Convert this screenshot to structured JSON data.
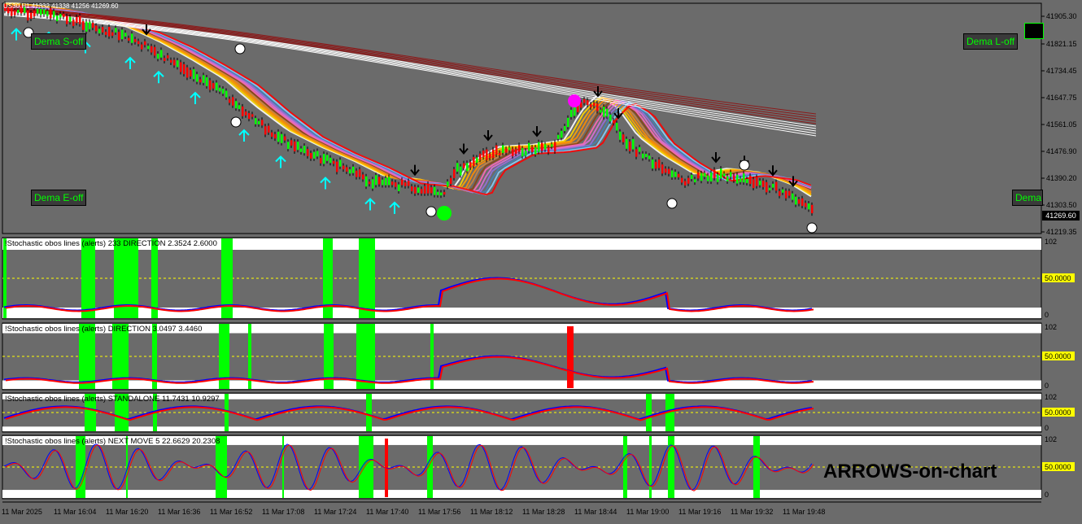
{
  "top_info": "US30.H1  41332  41338  41256  41269.60",
  "main_chart": {
    "buttons": [
      {
        "label": "Dema S-off"
      },
      {
        "label": "Dema L-off"
      },
      {
        "label": "Dema E-off"
      },
      {
        "label": "Dema U"
      }
    ],
    "price_ticks": [
      "41905.30",
      "41821.15",
      "41734.45",
      "41647.75",
      "41561.05",
      "41476.90",
      "41390.20",
      "41303.50",
      "41219.35"
    ],
    "current_price": "41269.60"
  },
  "indicators": [
    {
      "title": "!Stochastic obos lines (alerts) 233 DIRECTION 2.3524 2.6000",
      "levels": [
        "102",
        "50.0000",
        "0"
      ]
    },
    {
      "title": "!Stochastic obos lines (alerts) DIRECTION 3.0497 3.4460",
      "levels": [
        "102",
        "50.0000",
        "0"
      ]
    },
    {
      "title": "!Stochastic obos lines (alerts) STANDALONE 11.7431 10.9297",
      "levels": [
        "102",
        "50.0000",
        "0"
      ]
    },
    {
      "title": "!Stochastic obos lines (alerts) NEXT MOVE 5 22.6629 20.2308",
      "levels": [
        "102",
        "50.0000",
        "0"
      ]
    }
  ],
  "time_axis": [
    "11 Mar 2025",
    "11 Mar 16:04",
    "11 Mar 16:20",
    "11 Mar 16:36",
    "11 Mar 16:52",
    "11 Mar 17:08",
    "11 Mar 17:24",
    "11 Mar 17:40",
    "11 Mar 17:56",
    "11 Mar 18:12",
    "11 Mar 18:28",
    "11 Mar 18:44",
    "11 Mar 19:00",
    "11 Mar 19:16",
    "11 Mar 19:32",
    "11 Mar 19:48"
  ],
  "watermark": "ARROWS-on-chart",
  "colors": {
    "background": "#6b6b6b",
    "up": "#00ff00",
    "down": "#ff0000",
    "stoch_main": "#0000ff",
    "stoch_signal": "#ff0000",
    "signal_bar": "#00ff00",
    "level_line": "#ffff00"
  }
}
